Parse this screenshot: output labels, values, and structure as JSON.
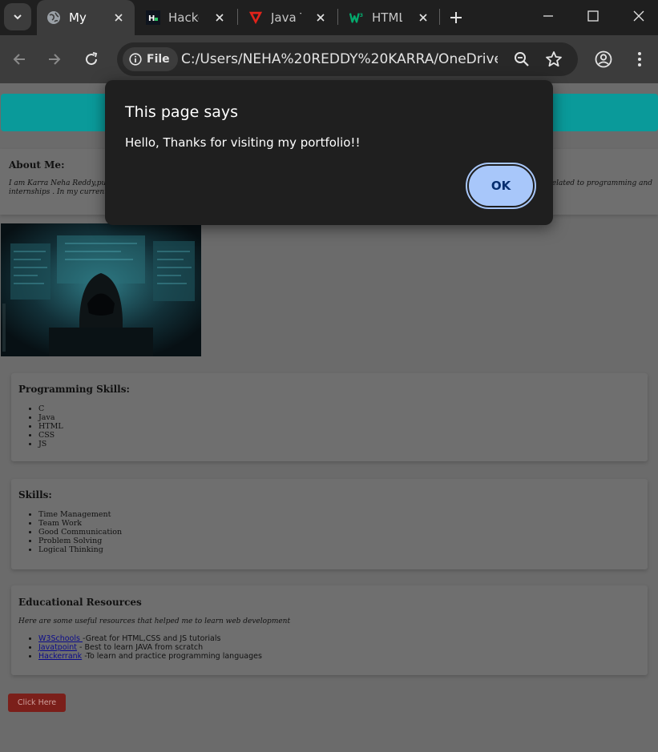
{
  "browser": {
    "tabs": [
      {
        "title": "My First",
        "favicon": "globe-icon",
        "active": true
      },
      {
        "title": "HackerRank",
        "favicon": "hackerrank-icon",
        "active": false
      },
      {
        "title": "Java Tutorial",
        "favicon": "javatpoint-icon",
        "active": false
      },
      {
        "title": "HTML Tutorial",
        "favicon": "w3schools-icon",
        "active": false
      }
    ],
    "new_tab_icon": "plus-icon",
    "omnibox": {
      "chip_label": "File",
      "url": "C:/Users/NEHA%20REDDY%20KARRA/OneDrive/..."
    }
  },
  "page": {
    "about": {
      "heading": "About Me:",
      "line1": "I am Karra Neha Reddy,pursu",
      "line1_tail": "s related to programming and",
      "line2": "internships . In my current rol"
    },
    "programming_skills": {
      "heading": "Programming Skills:",
      "items": [
        "C",
        "Java",
        "HTML",
        "CSS",
        "JS"
      ]
    },
    "skills": {
      "heading": "Skills:",
      "items": [
        "Time Management",
        "Team Work",
        "Good Communication",
        "Problem Solving",
        "Logical Thinking"
      ]
    },
    "resources": {
      "heading": "Educational Resources",
      "note": "Here are some useful resources that helped me to learn web development",
      "items": [
        {
          "link": "W3Schools ",
          "desc": "-Great for HTML,CSS and JS tutorials"
        },
        {
          "link": "Javatpoint",
          "desc": " - Best to learn JAVA from scratch"
        },
        {
          "link": "Hackerrank",
          "desc": " -To learn and practice programming languages"
        }
      ]
    },
    "button_label": "Click Here"
  },
  "dialog": {
    "title": "This page says",
    "message": "Hello, Thanks for visiting my portfolio!!",
    "ok_label": "OK",
    "accent": "#a8c7fa"
  }
}
